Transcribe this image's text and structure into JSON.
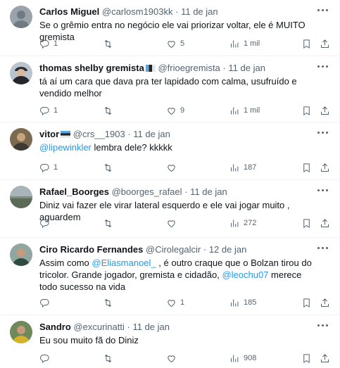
{
  "tweets": [
    {
      "name": "Carlos Miguel",
      "handle": "@carlosm1903kk",
      "date": "11 de jan",
      "text": "Se o grêmio entra no negócio ele vai priorizar voltar, ele é MUITO gremista",
      "reply": "1",
      "retweet": "",
      "like": "5",
      "views": "1 mil",
      "avatar": "gray-silhouette-icon"
    },
    {
      "name": "thomas shelby gremista",
      "handle": "@frioegremista",
      "date": "11 de jan",
      "text": "tá aí um cara que dava pra ter lapidado com calma, usufruído e vendido melhor",
      "reply": "1",
      "retweet": "",
      "like": "9",
      "views": "1 mil",
      "avatar": "man-in-cap-icon"
    },
    {
      "name": "vitor",
      "handle": "@crs__1903",
      "date": "11 de jan",
      "mention": "@lipewinkler",
      "text": " lembra dele? kkkkk",
      "reply": "1",
      "retweet": "",
      "like": "",
      "views": "187",
      "avatar": "person-photo-icon"
    },
    {
      "name": "Rafael_Boorges",
      "handle": "@boorges_rafael",
      "date": "11 de jan",
      "text": "Diniz vai fazer ele virar lateral esquerdo e ele vai jogar muito , aguardem",
      "reply": "",
      "retweet": "",
      "like": "",
      "views": "272",
      "avatar": "landscape-photo-icon"
    },
    {
      "name": "Ciro Ricardo Fernandes",
      "handle": "@Cirolegalcir",
      "date": "12 de jan",
      "text_a": "Assim como ",
      "mention_a": "@Eliasmanoel_",
      "text_b": " , é outro craque que o Bolzan tirou do tricolor. Grande jogador, gremista e  cidadão, ",
      "mention_b": "@leochu07",
      "text_c": "  merece todo sucesso na vida",
      "reply": "",
      "retweet": "",
      "like": "1",
      "views": "185",
      "avatar": "man-portrait-icon"
    },
    {
      "name": "Sandro",
      "handle": "@excurinatti",
      "date": "11 de jan",
      "text": "Eu sou muito fã do Diniz",
      "reply": "",
      "retweet": "",
      "like": "",
      "views": "908",
      "avatar": "man-in-yellow-icon"
    }
  ],
  "dot": "·",
  "colors": {
    "link": "#1d9bf0",
    "muted": "#536471",
    "text": "#0f1419",
    "divider": "#eff3f4"
  }
}
